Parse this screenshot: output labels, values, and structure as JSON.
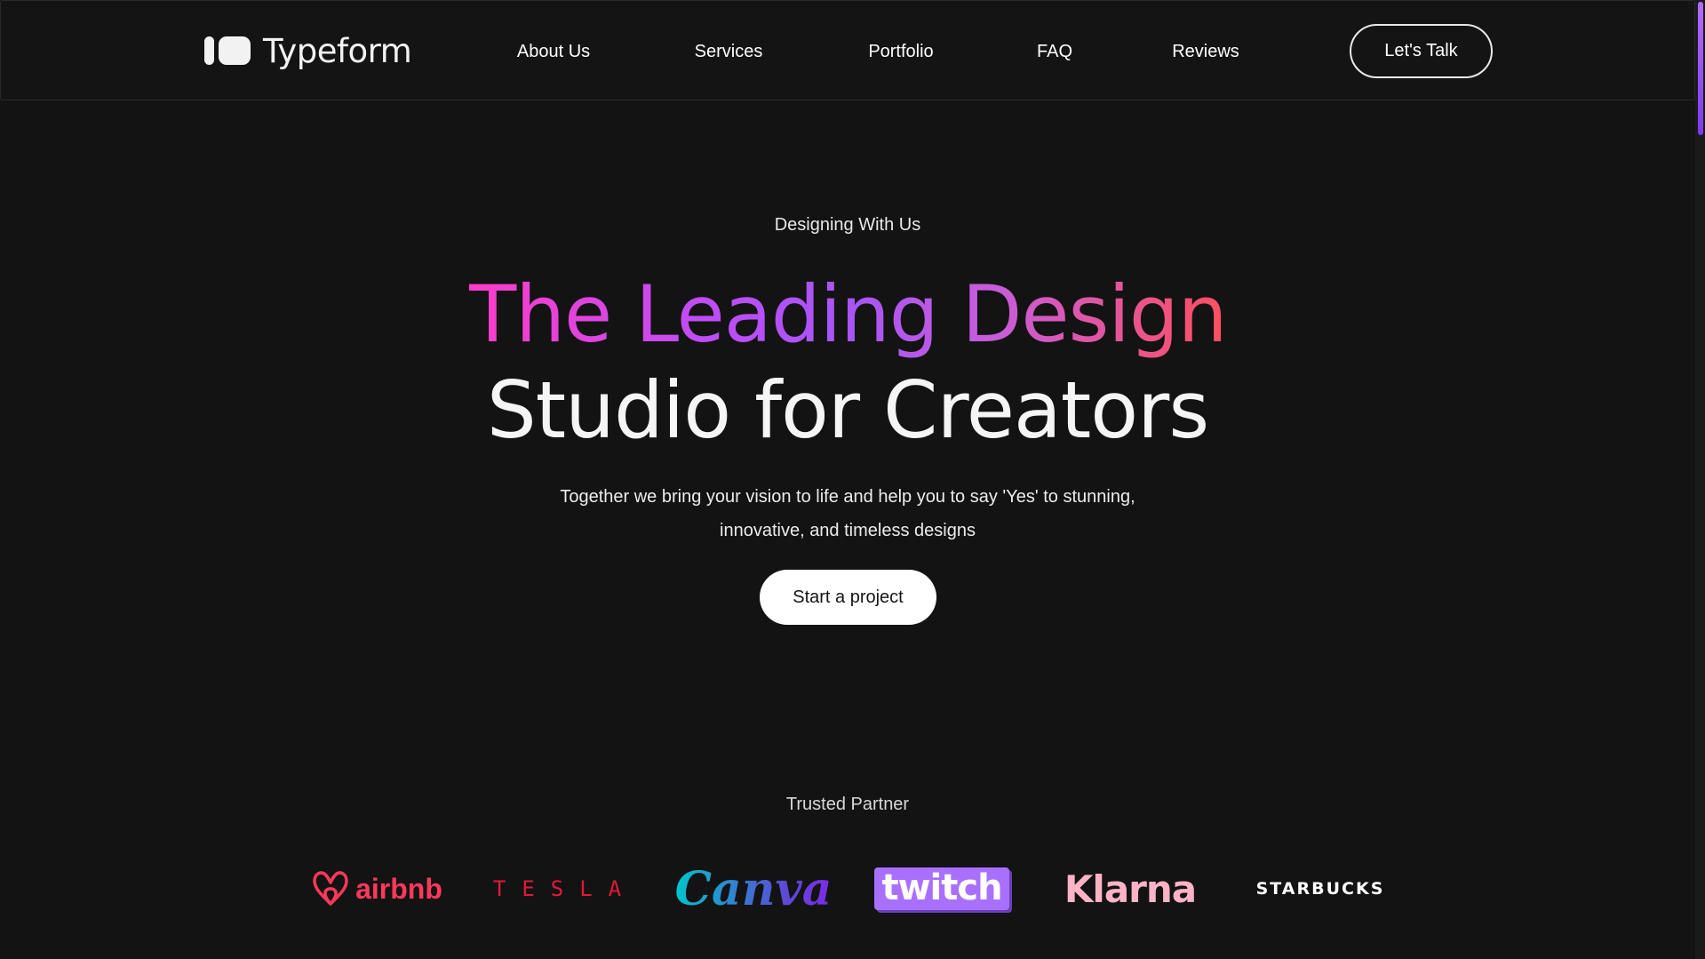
{
  "brand": {
    "name": "Typeform"
  },
  "nav": {
    "items": [
      {
        "label": "About Us"
      },
      {
        "label": "Services"
      },
      {
        "label": "Portfolio"
      },
      {
        "label": "FAQ"
      },
      {
        "label": "Reviews"
      }
    ],
    "cta_label": "Let's Talk"
  },
  "hero": {
    "eyebrow": "Designing With Us",
    "headline_line1": "The Leading Design",
    "headline_line2": "Studio for Creators",
    "subtext_line1": "Together we bring your vision to life and help you to say 'Yes' to stunning,",
    "subtext_line2": "innovative, and timeless designs",
    "button_label": "Start a project"
  },
  "partners": {
    "label": "Trusted Partner",
    "logos": [
      {
        "name": "airbnb",
        "text": "airbnb",
        "color": "#ff385c"
      },
      {
        "name": "tesla",
        "text": "TESLA",
        "color": "#e31937"
      },
      {
        "name": "canva",
        "text": "Canva",
        "color": "#00c4cc"
      },
      {
        "name": "twitch",
        "text": "twitch",
        "color": "#a970ff"
      },
      {
        "name": "klarna",
        "text": "Klarna",
        "color": "#ffb3c7"
      },
      {
        "name": "starbucks",
        "text": "STARBUCKS",
        "color": "#ffffff"
      }
    ]
  },
  "colors": {
    "background": "#131313",
    "gradient_start": "#ff3cc7",
    "gradient_mid": "#a855f7",
    "gradient_end": "#ff4f5e",
    "scrollbar_thumb": "#b46cff"
  }
}
